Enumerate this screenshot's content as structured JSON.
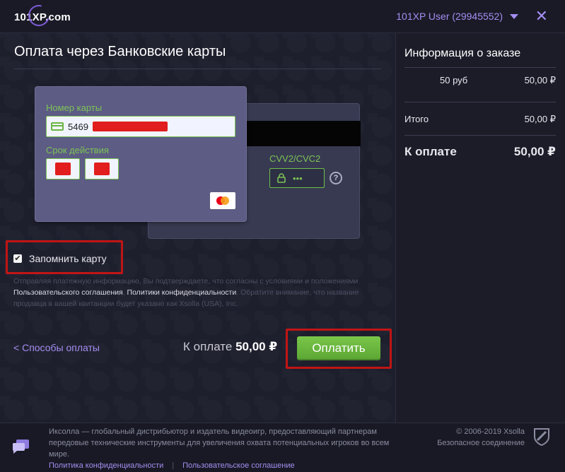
{
  "header": {
    "logo_text": "101XP.com",
    "user_label": "101XP User (29945552)",
    "close_glyph": "✕"
  },
  "main": {
    "title": "Оплата через Банковские карты",
    "card": {
      "number_label": "Номер карты",
      "number_prefix": "5469",
      "expiry_label": "Срок действия",
      "cvv_label": "CVV2/CVC2",
      "cvv_mask": "•••",
      "help_glyph": "?"
    },
    "remember_label": "Запомнить карту",
    "remember_checked": true,
    "legal": {
      "part1": "Отправляя платежную информацию, Вы подтверждаете, что согласны с условиями и положениями",
      "link1": "Пользовательского соглашения",
      "link2": "Политики конфиденциальности",
      "part2": ". Обратите внимание, что название продавца в вашей квитанции будет указано как Xsolla (USA), Inc."
    },
    "back_link": "Способы оплаты",
    "back_glyph": "<",
    "total_label": "К оплате",
    "total_value": "50,00 ₽",
    "pay_button": "Оплатить"
  },
  "order": {
    "title": "Информация о заказе",
    "item_name": "50 руб",
    "item_price": "50,00 ₽",
    "subtotal_label": "Итого",
    "subtotal_value": "50,00 ₽",
    "due_label": "К оплате",
    "due_value": "50,00 ₽"
  },
  "footer": {
    "description": "Иксолла — глобальный дистрибьютор и издатель видеоигр, предоставляющий партнерам передовые технические инструменты для увеличения охвата потенциальных игроков во всем мире.",
    "privacy_link": "Политика конфиденциальности",
    "separator": "|",
    "terms_link": "Пользовательское соглашение",
    "copyright": "© 2006-2019 Xsolla",
    "secure": "Безопасное соединение"
  },
  "colors": {
    "accent": "#a48ef0",
    "green": "#7cc455",
    "highlight": "#c01515"
  }
}
